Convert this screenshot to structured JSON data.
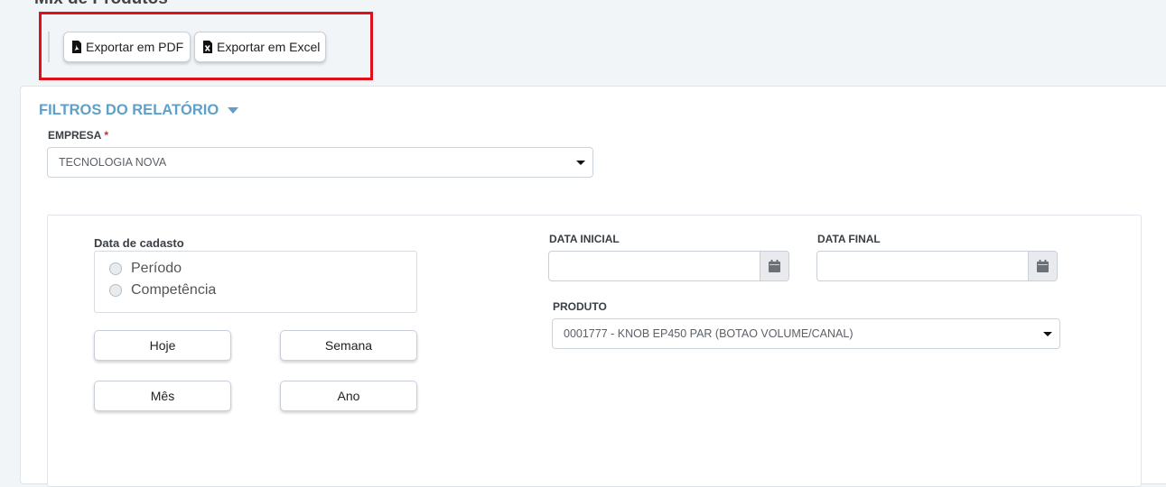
{
  "page": {
    "title_partial": "Mix de Produtos"
  },
  "export": {
    "pdf_label": "Exportar em PDF",
    "excel_label": "Exportar em Excel",
    "highlight_color": "#e0101a"
  },
  "filters": {
    "title": "FILTROS DO RELATÓRIO",
    "accent_color": "#5fa0c8",
    "empresa": {
      "label": "EMPRESA",
      "required_mark": "*",
      "value": "TECNOLOGIA NOVA"
    },
    "date_group": {
      "label": "Data de cadasto",
      "options": [
        "Período",
        "Competência"
      ]
    },
    "quick_buttons": {
      "today": "Hoje",
      "week": "Semana",
      "month": "Mês",
      "year": "Ano"
    },
    "data_inicial": {
      "label": "DATA INICIAL",
      "value": "",
      "icon": "calendar-icon"
    },
    "data_final": {
      "label": "DATA FINAL",
      "value": "",
      "icon": "calendar-icon"
    },
    "produto": {
      "label": "PRODUTO",
      "value": "0001777 - KNOB EP450 PAR (BOTAO VOLUME/CANAL)"
    }
  }
}
